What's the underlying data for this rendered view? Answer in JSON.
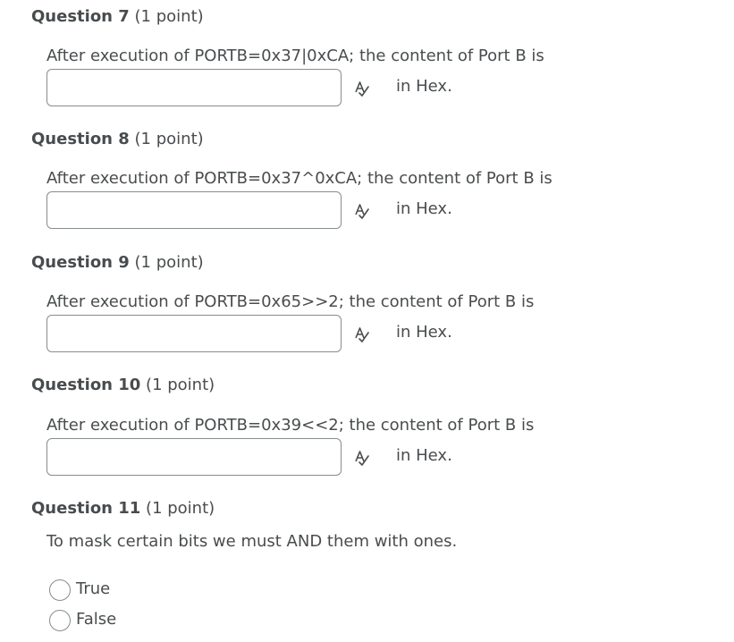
{
  "questions": [
    {
      "title": "Question 7",
      "points": "(1 point)",
      "prompt": "After execution of PORTB=0x37|0xCA; the content of Port B is",
      "answer_value": "",
      "suffix": "in Hex.",
      "icon": "spell-check-icon"
    },
    {
      "title": "Question 8",
      "points": "(1 point)",
      "prompt": "After execution of PORTB=0x37^0xCA; the content of Port B is",
      "answer_value": "",
      "suffix": "in Hex.",
      "icon": "spell-check-icon"
    },
    {
      "title": "Question 9",
      "points": "(1 point)",
      "prompt": "After execution of PORTB=0x65>>2; the content of Port B is",
      "answer_value": "",
      "suffix": "in Hex.",
      "icon": "spell-check-icon"
    },
    {
      "title": "Question 10",
      "points": "(1 point)",
      "prompt": "After execution of PORTB=0x39<<2; the content of Port B is",
      "answer_value": "",
      "suffix": "in Hex.",
      "icon": "spell-check-icon"
    },
    {
      "title": "Question 11",
      "points": "(1 point)",
      "prompt": "To mask certain bits we must AND them with ones.",
      "options": [
        "True",
        "False"
      ],
      "selected": null
    }
  ],
  "colors": {
    "text": "#494c4e",
    "input_border": "#868c8f",
    "background": "#ffffff"
  }
}
